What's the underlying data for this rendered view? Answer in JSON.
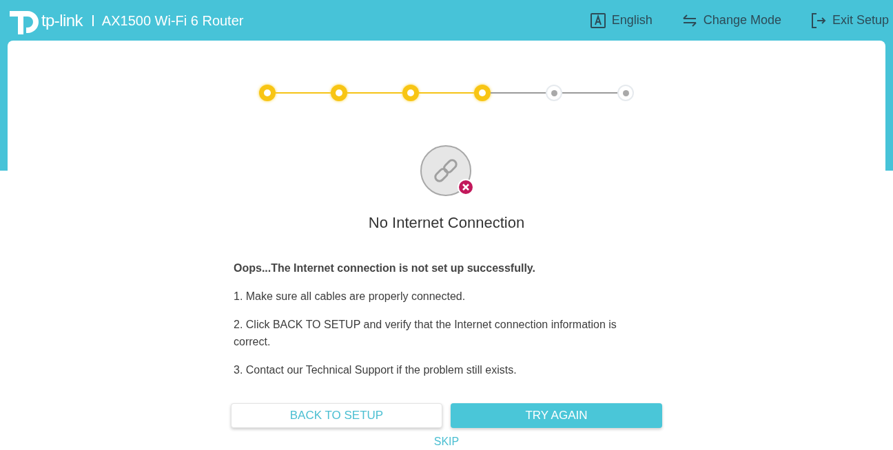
{
  "header": {
    "brand": "tp-link",
    "product": "AX1500 Wi-Fi 6 Router",
    "actions": [
      {
        "kind": "language",
        "label": "English"
      },
      {
        "kind": "mode",
        "label": "Change Mode"
      },
      {
        "kind": "exit",
        "label": "Exit Setup"
      }
    ]
  },
  "steps": [
    {
      "done": true
    },
    {
      "done": true
    },
    {
      "done": true
    },
    {
      "done": true
    },
    {
      "done": false
    },
    {
      "done": false
    }
  ],
  "status": {
    "title": "No Internet Connection"
  },
  "message": {
    "heading": "Oops...The Internet connection is not set up successfully.",
    "items": [
      "1. Make sure all cables are properly connected.",
      "2. Click BACK TO SETUP and verify that the Internet connection information is correct.",
      "3. Contact our Technical Support if the problem still exists."
    ]
  },
  "buttons": [
    {
      "kind": "secondary",
      "label": "BACK TO SETUP"
    },
    {
      "kind": "primary",
      "label": "TRY AGAIN"
    }
  ],
  "skip": "SKIP"
}
